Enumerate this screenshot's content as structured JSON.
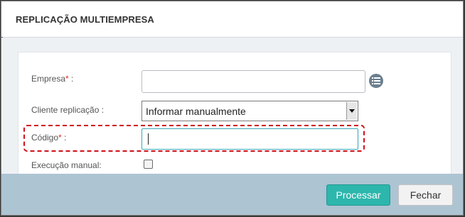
{
  "dialog": {
    "title": "REPLICAÇÃO MULTIEMPRESA"
  },
  "form": {
    "empresa": {
      "label": "Empresa",
      "required_mark": "*",
      "suffix": " :",
      "value": ""
    },
    "cliente_replicacao": {
      "label": "Cliente replicação :",
      "selected": "Informar manualmente"
    },
    "codigo": {
      "label": "Código",
      "required_mark": "*",
      "suffix": " :",
      "value": ""
    },
    "execucao_manual": {
      "label": "Execução manual:",
      "checked": false
    }
  },
  "footer": {
    "process_label": "Processar",
    "close_label": "Fechar"
  },
  "colors": {
    "primary_button": "#2db6ac",
    "required": "#e0301e",
    "highlight": "#d0101a",
    "footer": "#adc4d3"
  }
}
